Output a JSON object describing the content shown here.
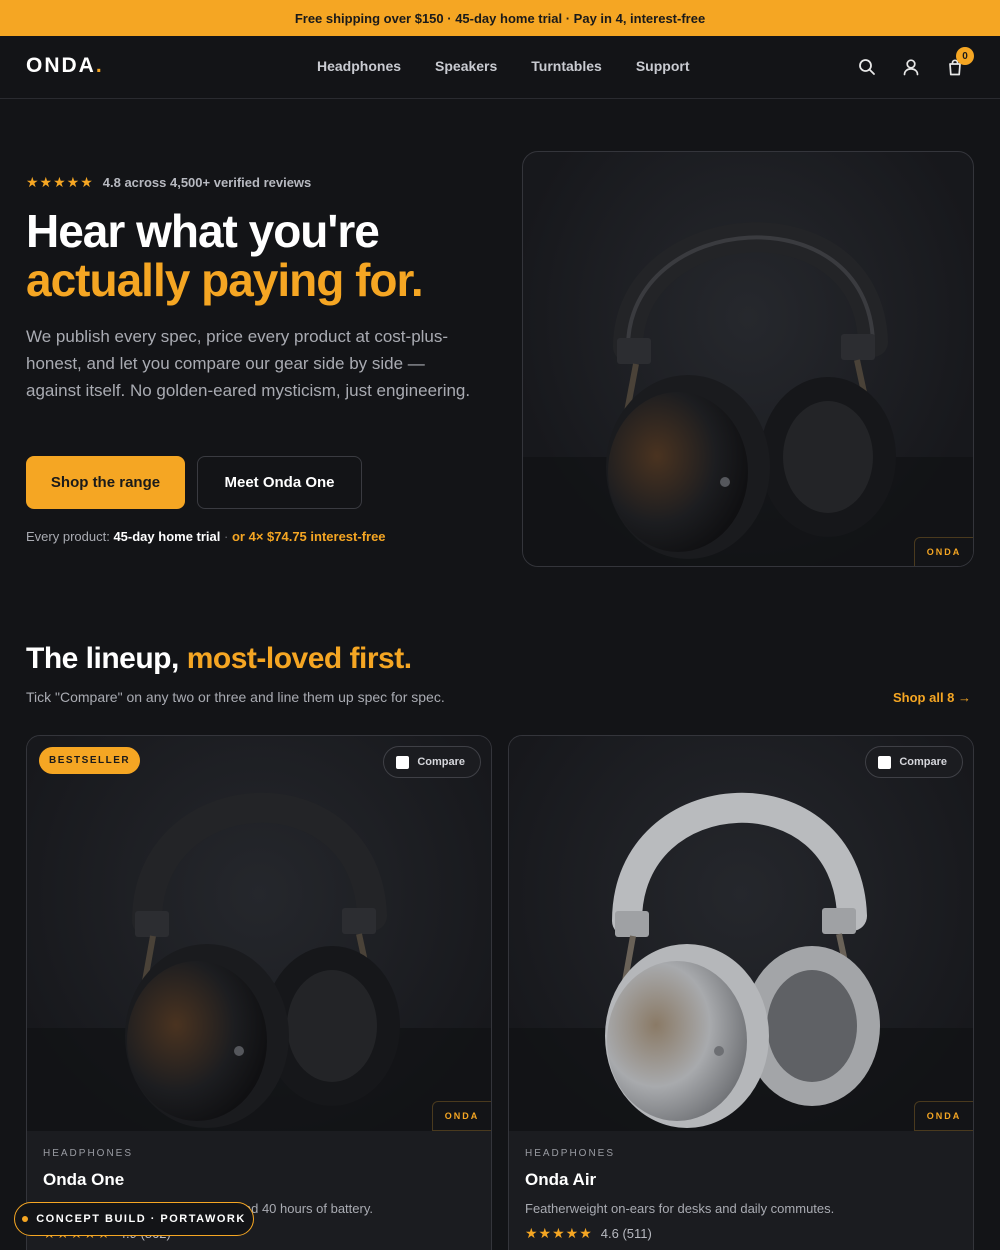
{
  "promo": {
    "text": "Free shipping over $150 · 45-day home trial · Pay in 4, interest-free"
  },
  "brand": {
    "name": "ONDA",
    "dot": "."
  },
  "nav": {
    "links": [
      "Headphones",
      "Speakers",
      "Turntables",
      "Support"
    ],
    "cart_count": "0",
    "icons": [
      "search-icon",
      "user-icon",
      "bag-icon"
    ]
  },
  "hero": {
    "stars": "★★★★★",
    "rating_text": "4.8 across 4,500+ verified reviews",
    "title_line1": "Hear what you're",
    "title_line2": "actually paying for.",
    "description": "We publish every spec, price every product at cost-plus-honest, and let you compare our gear side by side — against itself. No golden-eared mysticism, just engineering.",
    "primary_cta": "Shop the range",
    "secondary_cta": "Meet Onda One",
    "trial_prefix": "Every product:",
    "trial_bold": "45-day home trial",
    "trial_sep": "·",
    "trial_pay": "or 4× $74.75 interest-free",
    "card_tag": "ONDA"
  },
  "lineup": {
    "title": "The lineup,",
    "title_accent": "most-loved first.",
    "subtitle": "Tick \"Compare\" on any two or three and line them up spec for spec.",
    "shop_all": "Shop all 8 →",
    "products": [
      {
        "badge": "BESTSELLER",
        "compare_label": "Compare",
        "category": "HEADPHONES",
        "name": "Onda One",
        "description": "Studio-grade over-ears with ANC and 40 hours of battery.",
        "stars": "★★★★★",
        "rating": "4.9 (862)",
        "tag": "ONDA",
        "color": "#1e1f22"
      },
      {
        "badge": "",
        "compare_label": "Compare",
        "category": "HEADPHONES",
        "name": "Onda Air",
        "description": "Featherweight on-ears for desks and daily commutes.",
        "stars": "★★★★★",
        "rating": "4.6 (511)",
        "tag": "ONDA",
        "color": "#bfc1c4"
      }
    ]
  },
  "concept_badge": "CONCEPT BUILD · PORTAWORK",
  "colors": {
    "accent": "#f5a623",
    "background": "#131417",
    "card": "#1b1c20"
  }
}
